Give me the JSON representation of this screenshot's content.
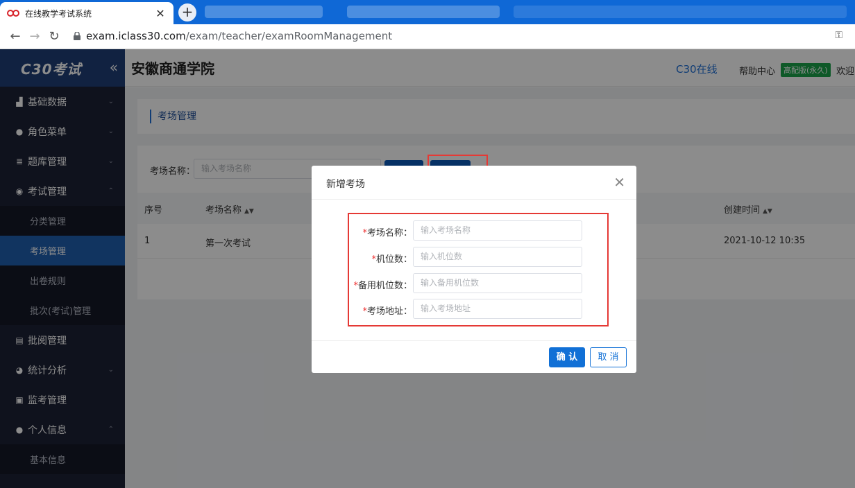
{
  "browser": {
    "tab_title": "在线教学考试系统",
    "tab_close": "✕",
    "new_tab": "+",
    "url_host": "exam.iclass30.com",
    "url_path": "/exam/teacher/examRoomManagement"
  },
  "sidebar": {
    "logo_text": "C30考试",
    "collapse": "«",
    "items": [
      {
        "label": "基础数据",
        "icon": "bar-chart-icon",
        "glyph": "▟",
        "chevron": "⌄"
      },
      {
        "label": "角色菜单",
        "icon": "user-icon",
        "glyph": "●",
        "chevron": "⌄"
      },
      {
        "label": "题库管理",
        "icon": "list-icon",
        "glyph": "≣",
        "chevron": "⌄"
      },
      {
        "label": "考试管理",
        "icon": "location-pin-icon",
        "glyph": "◉",
        "chevron": "⌃"
      },
      {
        "label": "批阅管理",
        "icon": "document-icon",
        "glyph": "▤"
      },
      {
        "label": "统计分析",
        "icon": "pie-chart-icon",
        "glyph": "◕",
        "chevron": "⌄"
      },
      {
        "label": "监考管理",
        "icon": "monitor-icon",
        "glyph": "▣"
      },
      {
        "label": "个人信息",
        "icon": "person-icon",
        "glyph": "●",
        "chevron": "⌃"
      }
    ],
    "exam_sub": [
      "分类管理",
      "考场管理",
      "出卷规则",
      "批次(考试)管理"
    ],
    "personal_sub": [
      "基本信息"
    ]
  },
  "header": {
    "school": "安徽商通学院",
    "c30": "C30在线",
    "help": "帮助中心",
    "badge": "高配版(永久)",
    "welcome": "欢迎"
  },
  "page": {
    "breadcrumb": "考场管理",
    "filter_label": "考场名称：",
    "filter_placeholder": "输入考场名称",
    "columns": [
      "序号",
      "考场名称",
      "创建时间"
    ],
    "rows": [
      {
        "index": "1",
        "name": "第一次考试",
        "created": "2021-10-12 10:35"
      }
    ]
  },
  "dialog": {
    "title": "新增考场",
    "close": "✕",
    "fields": [
      {
        "label": "考场名称：",
        "placeholder": "输入考场名称"
      },
      {
        "label": "机位数：",
        "placeholder": "输入机位数"
      },
      {
        "label": "备用机位数：",
        "placeholder": "输入备用机位数"
      },
      {
        "label": "考场地址：",
        "placeholder": "输入考场地址"
      }
    ],
    "required_mark": "*",
    "confirm": "确 认",
    "cancel": "取 消"
  },
  "colors": {
    "accent": "#1170d6",
    "sidebar_bg": "#1d2236",
    "highlight": "#e53935"
  }
}
